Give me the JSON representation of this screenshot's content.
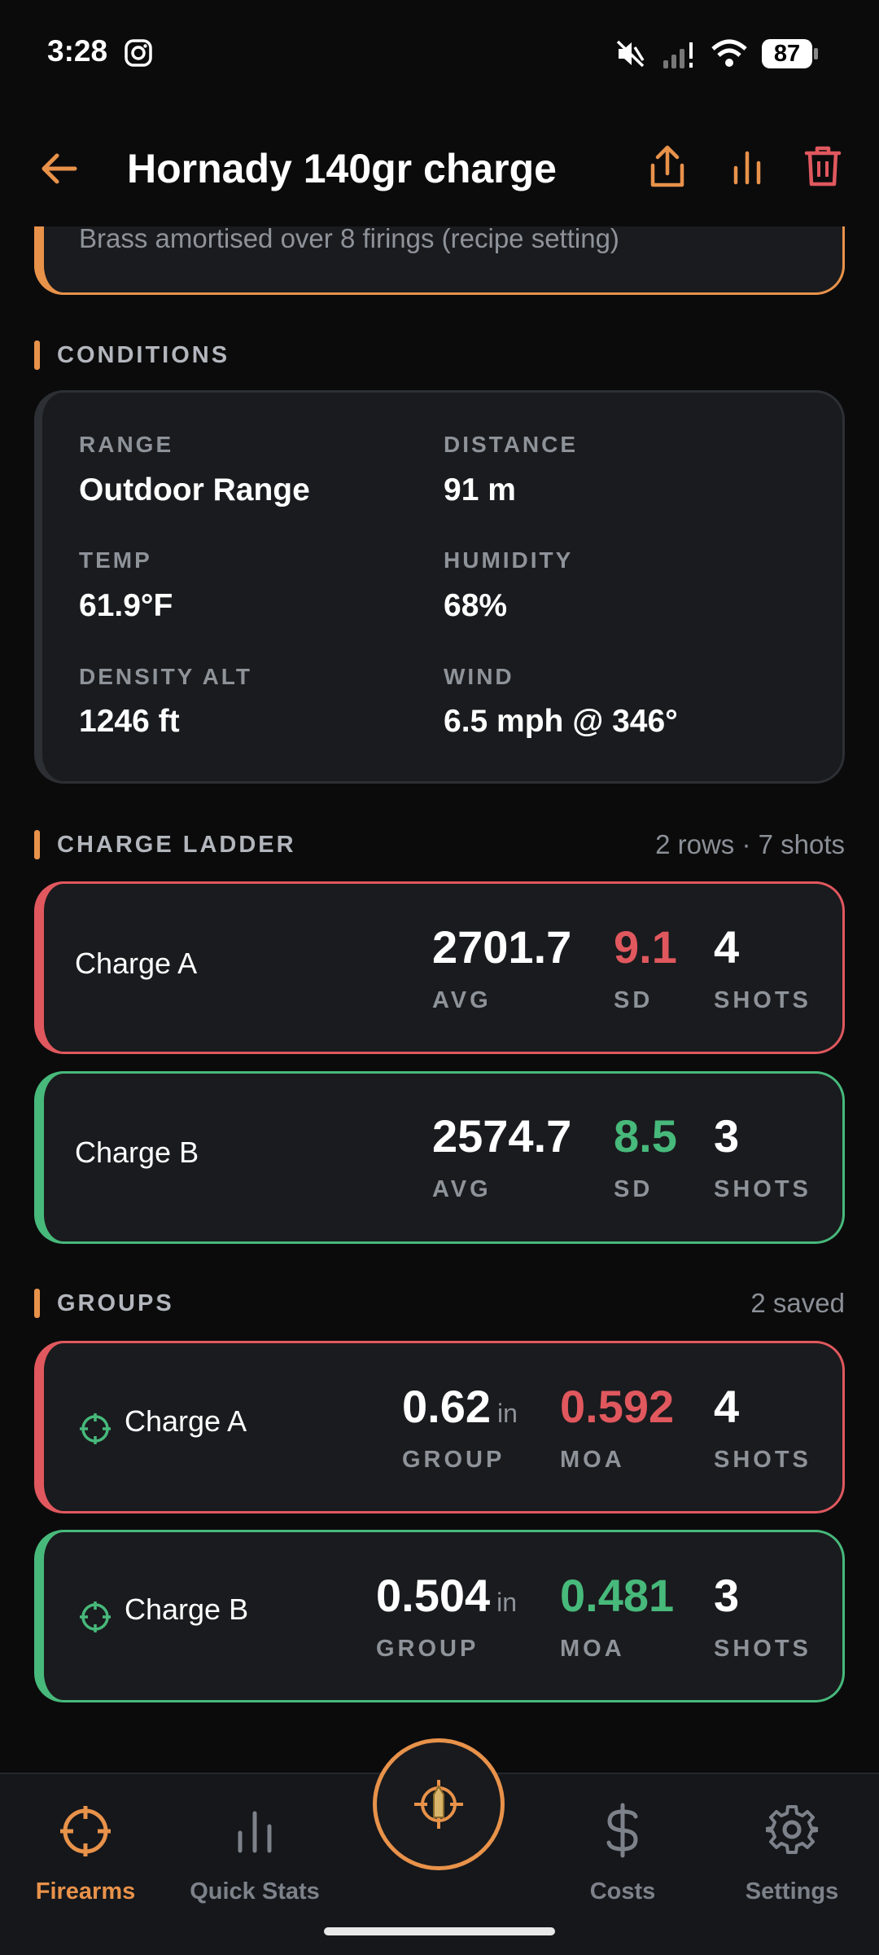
{
  "status_bar": {
    "time": "3:28",
    "battery": "87"
  },
  "header": {
    "title": "Hornady 140gr  charge"
  },
  "brass_note": "Brass amortised over 8 firings (recipe setting)",
  "conditions": {
    "section_title": "CONDITIONS",
    "items": [
      {
        "label": "RANGE",
        "value": "Outdoor Range"
      },
      {
        "label": "DISTANCE",
        "value": "91 m"
      },
      {
        "label": "TEMP",
        "value": "61.9°F"
      },
      {
        "label": "HUMIDITY",
        "value": "68%"
      },
      {
        "label": "DENSITY ALT",
        "value": "1246 ft"
      },
      {
        "label": "WIND",
        "value": "6.5 mph @ 346°"
      }
    ]
  },
  "charge_ladder": {
    "section_title": "CHARGE LADDER",
    "meta": "2 rows · 7 shots",
    "rows": [
      {
        "name": "Charge A",
        "avg": "2701.7",
        "avg_label": "AVG",
        "sd": "9.1",
        "sd_label": "SD",
        "shots": "4",
        "shots_label": "SHOTS",
        "accent": "#e0585e"
      },
      {
        "name": "Charge B",
        "avg": "2574.7",
        "avg_label": "AVG",
        "sd": "8.5",
        "sd_label": "SD",
        "shots": "3",
        "shots_label": "SHOTS",
        "accent": "#47b97b"
      }
    ]
  },
  "groups": {
    "section_title": "GROUPS",
    "meta": "2 saved",
    "rows": [
      {
        "name": "Charge A",
        "group": "0.62",
        "unit": "in",
        "group_label": "GROUP",
        "moa": "0.592",
        "moa_label": "MOA",
        "shots": "4",
        "shots_label": "SHOTS",
        "accent": "#e0585e"
      },
      {
        "name": "Charge B",
        "group": "0.504",
        "unit": "in",
        "group_label": "GROUP",
        "moa": "0.481",
        "moa_label": "MOA",
        "shots": "3",
        "shots_label": "SHOTS",
        "accent": "#47b97b"
      }
    ]
  },
  "bottom_nav": {
    "items": [
      {
        "label": "Firearms",
        "icon": "crosshair-icon",
        "active": true
      },
      {
        "label": "Quick Stats",
        "icon": "bar-chart-icon",
        "active": false
      },
      {
        "label": "Costs",
        "icon": "dollar-icon",
        "active": false
      },
      {
        "label": "Settings",
        "icon": "gear-icon",
        "active": false
      }
    ]
  },
  "colors": {
    "accent_orange": "#e8924a",
    "danger_red": "#e0585e",
    "success_green": "#47b97b",
    "background": "#0b0b0c",
    "card": "#1a1b1e"
  }
}
